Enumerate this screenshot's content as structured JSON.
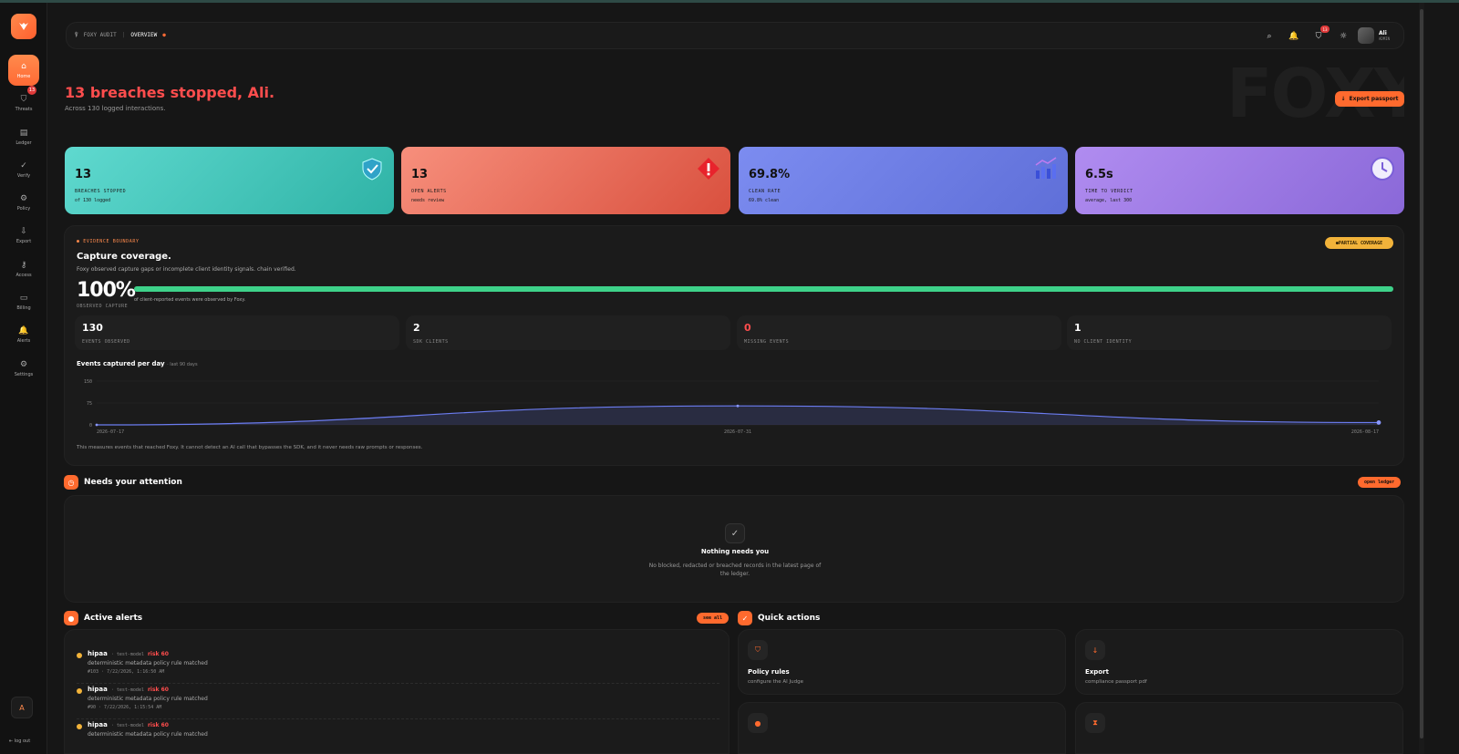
{
  "sidebar": {
    "items": [
      {
        "label": "Home",
        "icon": "⌂",
        "active": true
      },
      {
        "label": "Threats",
        "icon": "⛉",
        "badge": "13"
      },
      {
        "label": "Ledger",
        "icon": "▤"
      },
      {
        "label": "Verify",
        "icon": "✓"
      },
      {
        "label": "Policy",
        "icon": "⚙"
      },
      {
        "label": "Export",
        "icon": "⇩"
      },
      {
        "label": "Access",
        "icon": "⚷"
      },
      {
        "label": "Billing",
        "icon": "▭"
      },
      {
        "label": "Alerts",
        "icon": "🔔"
      },
      {
        "label": "Settings",
        "icon": "⚙"
      }
    ],
    "user_initial": "A",
    "logout": "⇤ log out"
  },
  "topbar": {
    "app": "FOXY AUDIT",
    "page": "OVERVIEW",
    "notif_badge": "13",
    "user_name": "Ali",
    "user_role": "ADMIN"
  },
  "hero": {
    "title": "13 breaches stopped, Ali.",
    "subtitle": "Across 130 logged interactions.",
    "watermark": "FOXY",
    "export_label": "Export passport"
  },
  "kpis": [
    {
      "value": "13",
      "label": "BREACHES STOPPED",
      "sub": "of 130 logged",
      "icon": "shield-icon",
      "color_from": "#5fd9cf",
      "color_to": "#2fb3a6"
    },
    {
      "value": "13",
      "label": "OPEN ALERTS",
      "sub": "needs review",
      "icon": "alert-diamond-icon",
      "color_from": "#f78f7c",
      "color_to": "#d9503e"
    },
    {
      "value": "69.8%",
      "label": "CLEAN RATE",
      "sub": "69.8% clean",
      "icon": "bar-chart-icon",
      "color_from": "#7c8cf0",
      "color_to": "#5f6fd8"
    },
    {
      "value": "6.5s",
      "label": "TIME TO VERDICT",
      "sub": "average, last 300",
      "icon": "clock-icon",
      "color_from": "#b08cf0",
      "color_to": "#8a68d8"
    }
  ],
  "evidence": {
    "kicker": "EVIDENCE BOUNDARY",
    "title": "Capture coverage.",
    "description": "Foxy observed capture gaps or incomplete client identity signals. chain verified.",
    "badge": "PARTIAL COVERAGE",
    "capture_pct": "100%",
    "capture_value": 100,
    "capture_label": "OBSERVED CAPTURE",
    "capture_caption": "of client-reported events were observed by Foxy.",
    "stats": [
      {
        "value": "130",
        "label": "EVENTS OBSERVED",
        "color": "#ffffff"
      },
      {
        "value": "2",
        "label": "SDK CLIENTS",
        "color": "#ffffff"
      },
      {
        "value": "0",
        "label": "MISSING EVENTS",
        "color": "#ff4d4d"
      },
      {
        "value": "1",
        "label": "NO CLIENT IDENTITY",
        "color": "#ffffff"
      }
    ],
    "chart_title": "Events captured per day",
    "chart_range": "· last 90 days",
    "note": "This measures events that reached Foxy. It cannot detect an AI call that bypasses the SDK, and it never needs raw prompts or responses."
  },
  "chart_data": {
    "type": "area",
    "x": [
      "2026-07-17",
      "2026-07-31",
      "2026-08-17"
    ],
    "values": [
      0,
      65,
      8
    ],
    "ylim": [
      0,
      150
    ],
    "yticks": [
      "0",
      "75",
      "150"
    ],
    "xticks": [
      "2026-07-17",
      "2026-07-31",
      "2026-08-17"
    ],
    "grid": true,
    "color": "#6b7cf0"
  },
  "attention": {
    "title": "Needs your attention",
    "button": "open ledger",
    "empty_title": "Nothing needs you",
    "empty_desc": "No blocked, redacted or breached records in the latest page of the ledger."
  },
  "alerts": {
    "title": "Active alerts",
    "button": "see all",
    "items": [
      {
        "name": "hipaa",
        "meta": "· test-model",
        "risk": "risk 60",
        "desc": "deterministic metadata policy rule matched",
        "time": "#103 · 7/22/2026, 1:16:50 AM"
      },
      {
        "name": "hipaa",
        "meta": "· test-model",
        "risk": "risk 60",
        "desc": "deterministic metadata policy rule matched",
        "time": "#90 · 7/22/2026, 1:15:54 AM"
      },
      {
        "name": "hipaa",
        "meta": "· test-model",
        "risk": "risk 60",
        "desc": "deterministic metadata policy rule matched",
        "time": ""
      }
    ]
  },
  "quick": {
    "title": "Quick actions",
    "items": [
      {
        "title": "Policy rules",
        "desc": "configure the AI Judge",
        "icon": "⛉"
      },
      {
        "title": "Export",
        "desc": "compliance passport pdf",
        "icon": "↓"
      },
      {
        "title": "",
        "desc": "",
        "icon": "●"
      },
      {
        "title": "",
        "desc": "",
        "icon": "⧗"
      }
    ]
  }
}
